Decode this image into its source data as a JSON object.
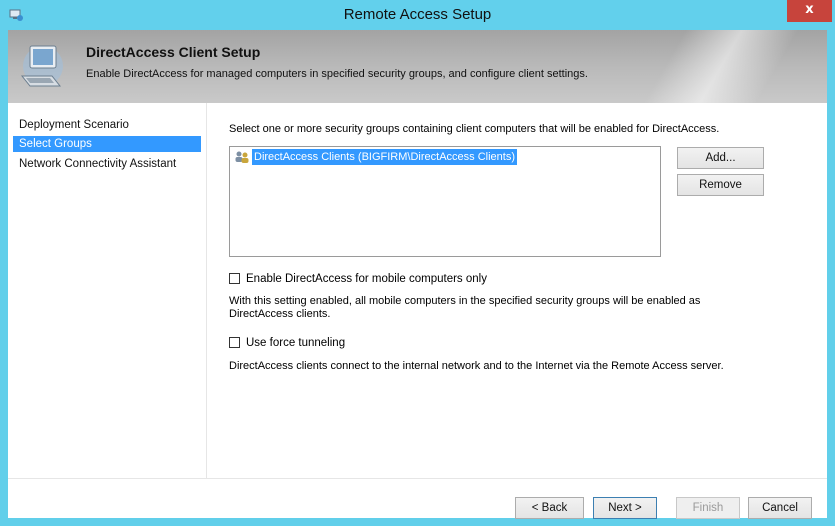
{
  "window": {
    "title": "Remote Access Setup",
    "close_label": "x"
  },
  "header": {
    "title": "DirectAccess Client Setup",
    "subtitle": "Enable DirectAccess for managed computers in specified security groups, and configure client settings."
  },
  "nav": {
    "items": [
      {
        "label": "Deployment Scenario",
        "selected": false
      },
      {
        "label": "Select Groups",
        "selected": true
      },
      {
        "label": "Network Connectivity Assistant",
        "selected": false
      }
    ]
  },
  "content": {
    "description": "Select one or more security groups containing client computers that will be enabled for DirectAccess.",
    "groups": [
      {
        "label": "DirectAccess Clients (BIGFIRM\\DirectAccess Clients)",
        "selected": true
      }
    ],
    "add_label": "Add...",
    "remove_label": "Remove",
    "mobile_only": {
      "label": "Enable DirectAccess for mobile computers only",
      "checked": false,
      "info_line1": "With this setting enabled, all mobile computers in the specified security groups will be enabled as",
      "info_line2": "DirectAccess clients."
    },
    "force_tunneling": {
      "label": "Use force tunneling",
      "checked": false,
      "info": "DirectAccess clients connect to the internal network and to the Internet via the Remote Access server."
    }
  },
  "footer": {
    "back_label": "< Back",
    "next_label": "Next >",
    "finish_label": "Finish",
    "cancel_label": "Cancel"
  },
  "colors": {
    "titlebar": "#62d0ec",
    "close": "#c7443c",
    "selection": "#3399ff"
  },
  "icons": {
    "app": "remote-access-icon",
    "header": "computer-icon",
    "group": "user-group-icon"
  }
}
